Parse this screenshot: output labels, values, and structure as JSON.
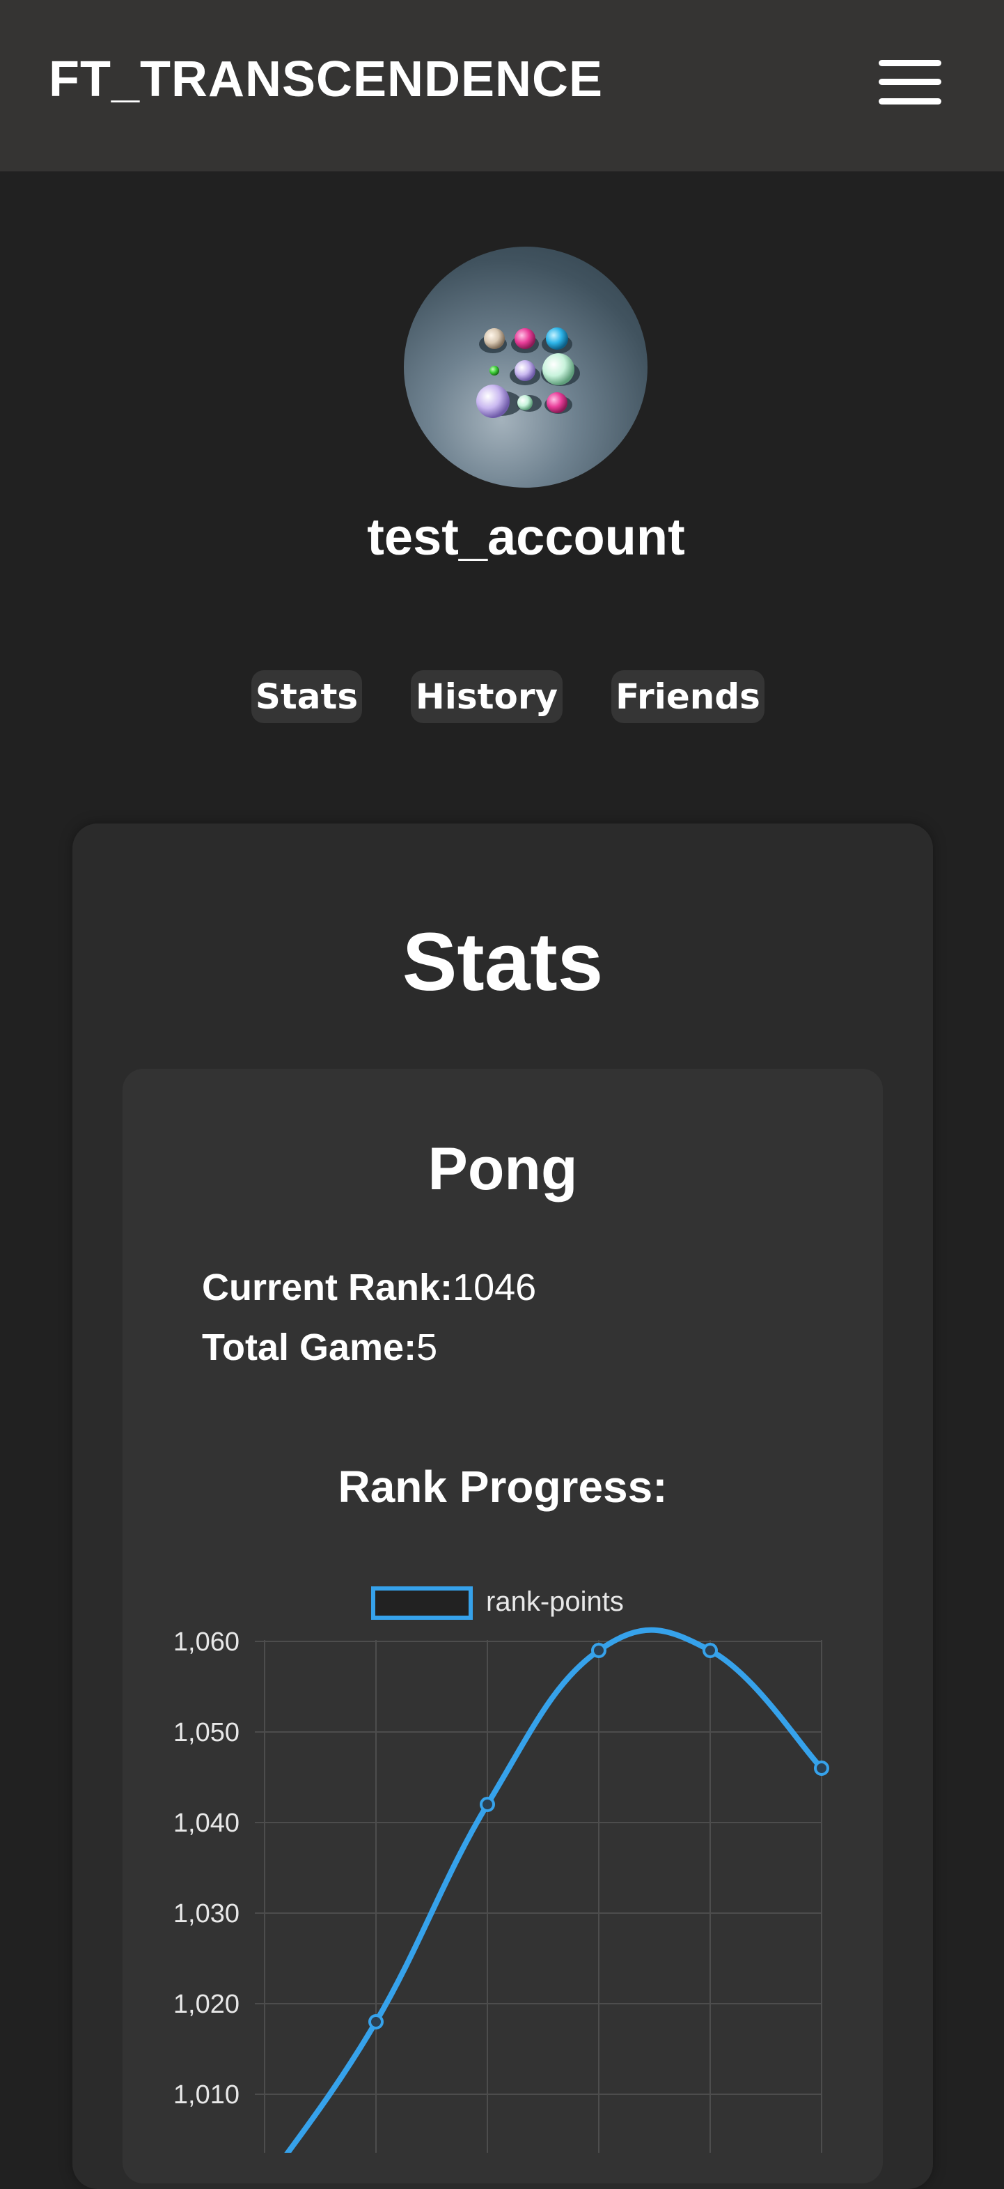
{
  "navbar": {
    "brand": "FT_TRANSCENDENCE",
    "menu_icon": "hamburger-menu-icon"
  },
  "profile": {
    "username": "test_account",
    "avatar_icon": "colorful-spheres-avatar"
  },
  "tabs": [
    {
      "label": "Stats"
    },
    {
      "label": "History"
    },
    {
      "label": "Friends"
    }
  ],
  "stats": {
    "title": "Stats",
    "game": {
      "title": "Pong",
      "current_rank_label": "Current Rank:",
      "current_rank_value": "1046",
      "total_game_label": "Total Game:",
      "total_game_value": "5"
    },
    "progress_title": "Rank Progress:"
  },
  "colors": {
    "background": "#212121",
    "navbar": "#353433",
    "card": "#2b2b2b",
    "inner_card": "#333333",
    "accent": "#36a2eb"
  },
  "chart_data": {
    "type": "line",
    "title": "",
    "xlabel": "",
    "ylabel": "",
    "ylim": [
      1000,
      1060
    ],
    "yticks": [
      1010,
      1020,
      1030,
      1040,
      1050,
      1060
    ],
    "grid": true,
    "legend": "top-center",
    "series": [
      {
        "name": "rank-points",
        "color": "#36a2eb",
        "values": [
          1000,
          1018,
          1042,
          1059,
          1059,
          1046
        ]
      }
    ]
  }
}
